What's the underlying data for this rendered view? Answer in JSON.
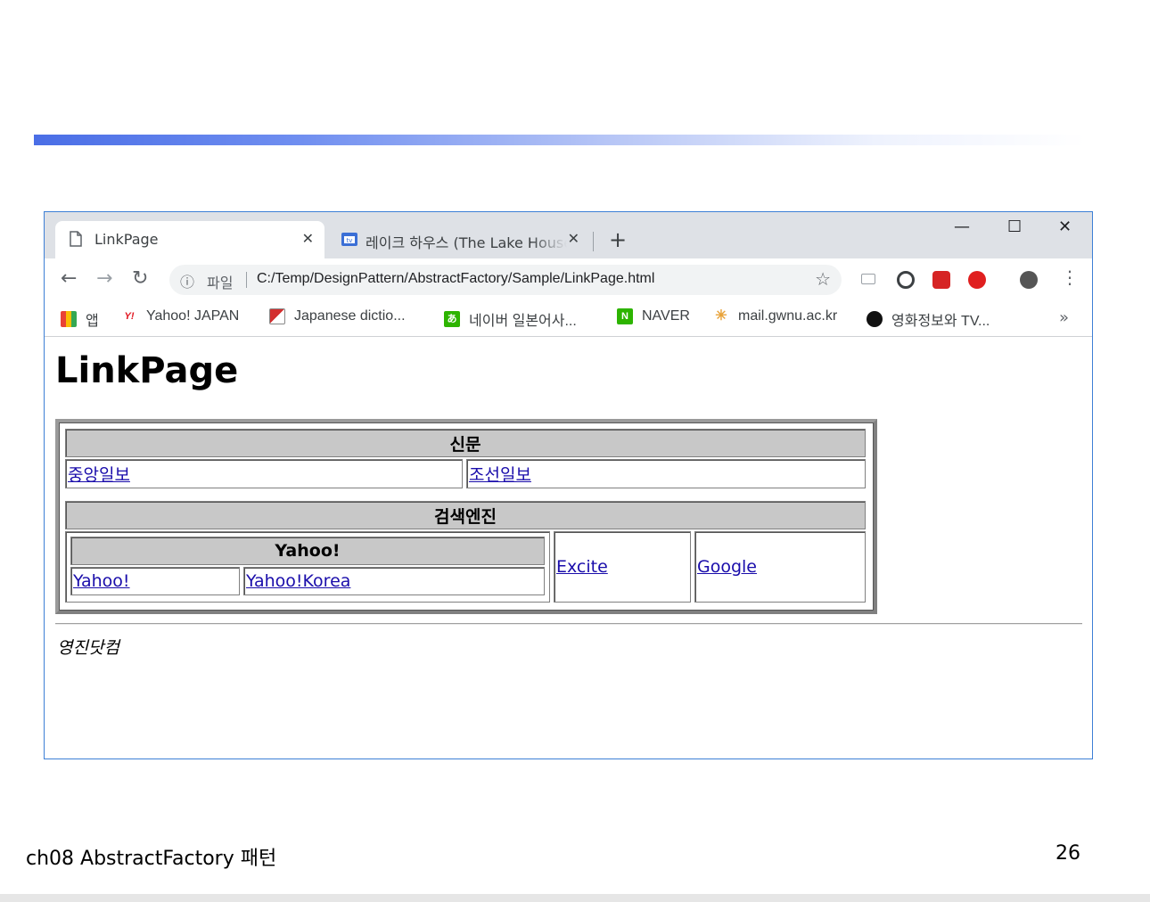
{
  "browser": {
    "tabs": [
      {
        "title": "LinkPage",
        "active": true
      },
      {
        "title": "레이크 하우스 (The Lake House)",
        "active": false
      }
    ],
    "toolbar": {
      "info_icon": "ⓘ",
      "file_label": "파일",
      "url": "C:/Temp/DesignPattern/AbstractFactory/Sample/LinkPage.html"
    },
    "bookmarks": [
      {
        "label": "앱",
        "icon": "apps-grid-icon"
      },
      {
        "label": "Yahoo! JAPAN",
        "icon": "yahoo-icon",
        "glyph": "Y!"
      },
      {
        "label": "Japanese dictio...",
        "icon": "dictionary-icon"
      },
      {
        "label": "네이버 일본어사...",
        "icon": "naver-jp-icon",
        "glyph": "あ"
      },
      {
        "label": "NAVER",
        "icon": "naver-icon",
        "glyph": "N"
      },
      {
        "label": "mail.gwnu.ac.kr",
        "icon": "mail-icon"
      },
      {
        "label": "영화정보와 TV...",
        "icon": "film-reel-icon"
      }
    ],
    "bookmarks_more": "»"
  },
  "page": {
    "heading": "LinkPage",
    "newspaper_header": "신문",
    "newspaper_links": [
      "중앙일보",
      "조선일보"
    ],
    "search_header": "검색엔진",
    "yahoo_header": "Yahoo!",
    "yahoo_links": [
      "Yahoo!",
      "Yahoo!Korea"
    ],
    "other_links": [
      "Excite",
      "Google"
    ],
    "address": "영진닷컴"
  },
  "slide": {
    "footer_title": "ch08 AbstractFactory 패턴",
    "page_number": "26"
  },
  "colors": {
    "accent_bar": "#4a6ee6",
    "link": "#1a0dab",
    "table_header_bg": "#c8c8c8",
    "browser_frame": "#3d7fd6"
  }
}
